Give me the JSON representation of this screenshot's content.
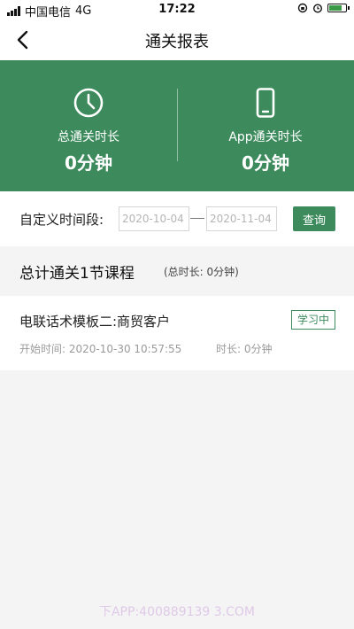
{
  "status_bar": {
    "carrier": "中国电信",
    "network": "4G",
    "time": "17:22"
  },
  "navbar": {
    "title": "通关报表",
    "back_icon": "chevron-left-icon"
  },
  "summary": {
    "total_label": "总通关时长",
    "total_value": "0分钟",
    "total_icon": "clock-icon",
    "app_label": "App通关时长",
    "app_value": "0分钟",
    "app_icon": "phone-icon"
  },
  "filter": {
    "label": "自定义时间段:",
    "start_date": "2020-10-04",
    "end_date": "2020-11-04",
    "query_label": "查询"
  },
  "total": {
    "title": "总计通关1节课程",
    "subtitle": "(总时长: 0分钟)"
  },
  "courses": [
    {
      "title": "电联话术模板二:商贸客户",
      "status": "学习中",
      "start_time": "开始时间: 2020-10-30 10:57:55",
      "duration": "时长: 0分钟"
    }
  ],
  "watermark": "下APP:400889139 3.COM",
  "colors": {
    "brand": "#3d8b5d",
    "page_bg": "#f4f4f4"
  }
}
